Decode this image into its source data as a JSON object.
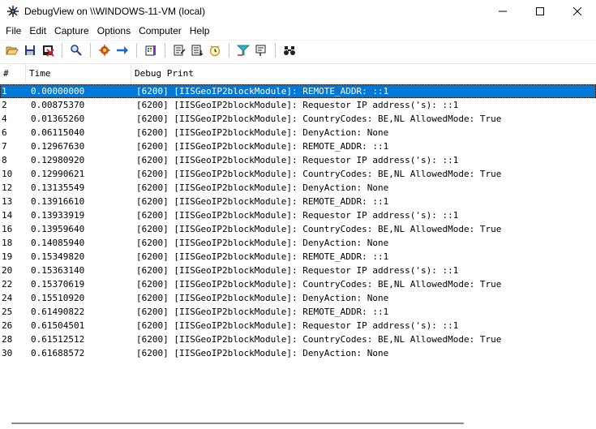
{
  "window": {
    "title": "DebugView on \\\\WINDOWS-11-VM (local)"
  },
  "menu": {
    "items": [
      "File",
      "Edit",
      "Capture",
      "Options",
      "Computer",
      "Help"
    ]
  },
  "table": {
    "columns": [
      "#",
      "Time",
      "Debug Print"
    ],
    "rows": [
      {
        "num": "1",
        "time": "0.00000000",
        "print": "[6200] [IISGeoIP2blockModule]: REMOTE_ADDR: ::1",
        "selected": true
      },
      {
        "num": "2",
        "time": "0.00875370",
        "print": "[6200] [IISGeoIP2blockModule]: Requestor IP address('s): ::1"
      },
      {
        "num": "4",
        "time": "0.01365260",
        "print": "[6200] [IISGeoIP2blockModule]: CountryCodes: BE,NL AllowedMode: True"
      },
      {
        "num": "6",
        "time": "0.06115040",
        "print": "[6200] [IISGeoIP2blockModule]: DenyAction: None"
      },
      {
        "num": "7",
        "time": "0.12967630",
        "print": "[6200] [IISGeoIP2blockModule]: REMOTE_ADDR: ::1"
      },
      {
        "num": "8",
        "time": "0.12980920",
        "print": "[6200] [IISGeoIP2blockModule]: Requestor IP address('s): ::1"
      },
      {
        "num": "10",
        "time": "0.12990621",
        "print": "[6200] [IISGeoIP2blockModule]: CountryCodes: BE,NL AllowedMode: True"
      },
      {
        "num": "12",
        "time": "0.13135549",
        "print": "[6200] [IISGeoIP2blockModule]: DenyAction: None"
      },
      {
        "num": "13",
        "time": "0.13916610",
        "print": "[6200] [IISGeoIP2blockModule]: REMOTE_ADDR: ::1"
      },
      {
        "num": "14",
        "time": "0.13933919",
        "print": "[6200] [IISGeoIP2blockModule]: Requestor IP address('s): ::1"
      },
      {
        "num": "16",
        "time": "0.13959640",
        "print": "[6200] [IISGeoIP2blockModule]: CountryCodes: BE,NL AllowedMode: True"
      },
      {
        "num": "18",
        "time": "0.14085940",
        "print": "[6200] [IISGeoIP2blockModule]: DenyAction: None"
      },
      {
        "num": "19",
        "time": "0.15349820",
        "print": "[6200] [IISGeoIP2blockModule]: REMOTE_ADDR: ::1"
      },
      {
        "num": "20",
        "time": "0.15363140",
        "print": "[6200] [IISGeoIP2blockModule]: Requestor IP address('s): ::1"
      },
      {
        "num": "22",
        "time": "0.15370619",
        "print": "[6200] [IISGeoIP2blockModule]: CountryCodes: BE,NL AllowedMode: True"
      },
      {
        "num": "24",
        "time": "0.15510920",
        "print": "[6200] [IISGeoIP2blockModule]: DenyAction: None"
      },
      {
        "num": "25",
        "time": "0.61490822",
        "print": "[6200] [IISGeoIP2blockModule]: REMOTE_ADDR: ::1"
      },
      {
        "num": "26",
        "time": "0.61504501",
        "print": "[6200] [IISGeoIP2blockModule]: Requestor IP address('s): ::1"
      },
      {
        "num": "28",
        "time": "0.61512512",
        "print": "[6200] [IISGeoIP2blockModule]: CountryCodes: BE,NL AllowedMode: True"
      },
      {
        "num": "30",
        "time": "0.61688572",
        "print": "[6200] [IISGeoIP2blockModule]: DenyAction: None"
      }
    ]
  },
  "colors": {
    "selection": "#0078d7",
    "separator": "#c8c8c8"
  },
  "icons": {
    "toolbar": [
      "open-folder-icon",
      "save-icon",
      "clear-display-icon",
      "find-icon",
      "capture-icon",
      "autoscroll-icon",
      "capture-kernel-icon",
      "highlight-icon",
      "history-icon",
      "clock-time-icon",
      "filter-icon",
      "highlight-filter-icon",
      "find-binoculars-icon"
    ]
  }
}
